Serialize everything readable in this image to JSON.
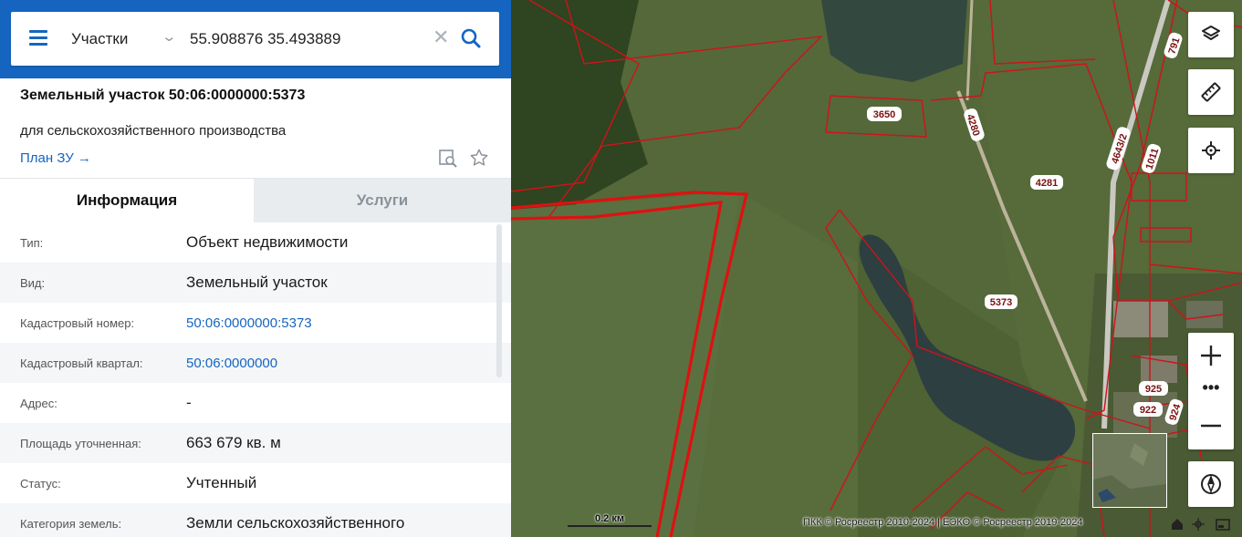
{
  "search": {
    "type_label": "Участки",
    "query": "55.908876 35.493889"
  },
  "parcel": {
    "title": "Земельный участок 50:06:0000000:5373",
    "purpose": "для сельскохозяйственного производства",
    "plan_link": "План ЗУ →"
  },
  "tabs": [
    {
      "label": "Информация",
      "active": true
    },
    {
      "label": "Услуги",
      "active": false
    }
  ],
  "info_rows": [
    {
      "label": "Тип:",
      "value": "Объект недвижимости",
      "link": false
    },
    {
      "label": "Вид:",
      "value": "Земельный участок",
      "link": false
    },
    {
      "label": "Кадастровый номер:",
      "value": "50:06:0000000:5373",
      "link": true
    },
    {
      "label": "Кадастровый квартал:",
      "value": "50:06:0000000",
      "link": true
    },
    {
      "label": "Адрес:",
      "value": "-",
      "link": false
    },
    {
      "label": "Площадь уточненная:",
      "value": "663 679 кв. м",
      "link": false
    },
    {
      "label": "Статус:",
      "value": "Учтенный",
      "link": false
    },
    {
      "label": "Категория земель:",
      "value": "Земли сельскохозяйственного",
      "link": false
    }
  ],
  "map": {
    "parcel_labels": [
      "3650",
      "4280",
      "4281",
      "5373",
      "4643/2",
      "1011",
      "791",
      "925",
      "922",
      "924"
    ],
    "scale_label": "0.2 км",
    "attribution": "ПКК © Росреестр 2010-2024 | ЕЭКО © Росреестр 2019-2024",
    "controls": [
      "layers-icon",
      "ruler-icon",
      "locate-icon",
      "zoom-in-icon",
      "more-icon",
      "zoom-out-icon",
      "compass-icon"
    ],
    "more_label": "•••"
  },
  "colors": {
    "header": "#1565c0",
    "link": "#1565c0",
    "parcel_border": "#d0121b",
    "selected_border": "#e01010"
  }
}
